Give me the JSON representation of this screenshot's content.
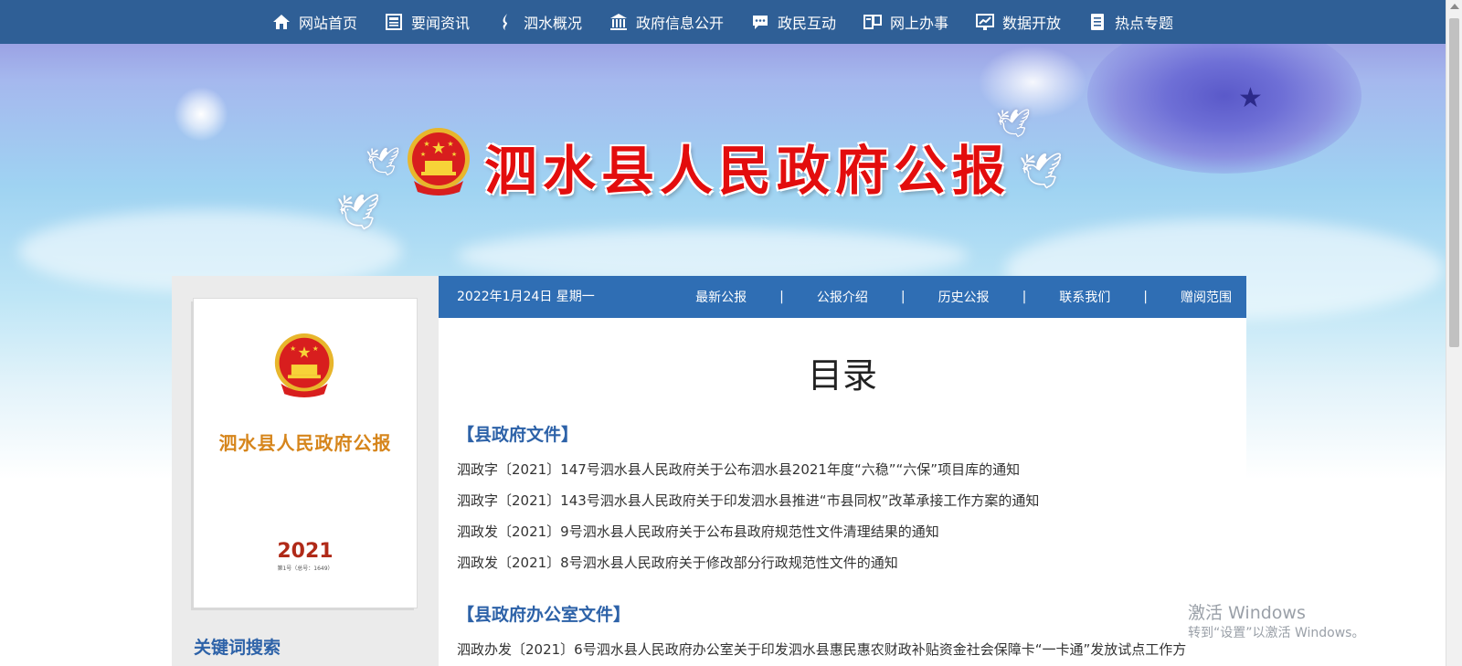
{
  "topnav": {
    "items": [
      {
        "label": "网站首页",
        "icon": "home-icon"
      },
      {
        "label": "要闻资讯",
        "icon": "news-icon"
      },
      {
        "label": "泗水概况",
        "icon": "water-drop-icon"
      },
      {
        "label": "政府信息公开",
        "icon": "government-building-icon"
      },
      {
        "label": "政民互动",
        "icon": "chat-bubble-icon"
      },
      {
        "label": "网上办事",
        "icon": "online-service-icon"
      },
      {
        "label": "数据开放",
        "icon": "data-chart-icon"
      },
      {
        "label": "热点专题",
        "icon": "document-list-icon"
      }
    ]
  },
  "banner": {
    "title": "泗水县人民政府公报"
  },
  "cover": {
    "title": "泗水县人民政府公报",
    "year": "2021",
    "issue": "第1号（总号：1649）"
  },
  "left": {
    "search_title": "关键词搜索"
  },
  "subnav": {
    "date": "2022年1月24日 星期一",
    "links": [
      "最新公报",
      "公报介绍",
      "历史公报",
      "联系我们",
      "赠阅范围"
    ],
    "separator": "|"
  },
  "main": {
    "heading": "目录",
    "sections": [
      {
        "title": "【县政府文件】",
        "docs": [
          "泗政字〔2021〕147号泗水县人民政府关于公布泗水县2021年度“六稳”“六保”项目库的通知",
          "泗政字〔2021〕143号泗水县人民政府关于印发泗水县推进“市县同权”改革承接工作方案的通知",
          "泗政发〔2021〕9号泗水县人民政府关于公布县政府规范性文件清理结果的通知",
          "泗政发〔2021〕8号泗水县人民政府关于修改部分行政规范性文件的通知"
        ]
      },
      {
        "title": "【县政府办公室文件】",
        "docs": [
          "泗政办发〔2021〕6号泗水县人民政府办公室关于印发泗水县惠民惠农财政补贴资金社会保障卡“一卡通”发放试点工作方"
        ]
      }
    ]
  },
  "watermark": {
    "line1": "激活 Windows",
    "line2": "转到“设置”以激活 Windows。"
  },
  "colors": {
    "nav_bg": "#2f5f96",
    "subnav_bg": "#2f6eb4",
    "title_red": "#e30d0d",
    "section_blue": "#2d62a8"
  }
}
